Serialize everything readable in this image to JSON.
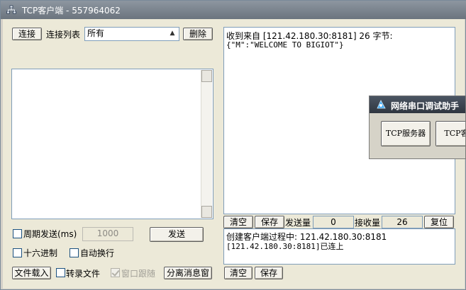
{
  "window": {
    "title": "TCP客户端 - 557964062"
  },
  "toolbar": {
    "connect_label": "连接",
    "conn_list_label": "连接列表",
    "conn_select_value": "所有",
    "delete_label": "删除"
  },
  "receive": {
    "lines": [
      "收到来自 [121.42.180.30:8181] 26 字节:",
      "{\"M\":\"WELCOME TO BIGIOT\"}"
    ]
  },
  "rx_bar": {
    "clear_label": "清空",
    "save_label": "保存",
    "sent_label": "发送量",
    "sent_value": "0",
    "recv_label": "接收量",
    "recv_value": "26",
    "reset_label": "复位"
  },
  "send_panel": {
    "periodic_label": "周期发送(ms)",
    "periodic_value": "1000",
    "send_label": "发送",
    "hex_label": "十六进制",
    "autowrap_label": "自动换行",
    "load_file_label": "文件载入",
    "to_file_label": "转录文件",
    "follow_label": "窗口跟随",
    "detach_label": "分离消息窗"
  },
  "log": {
    "lines": [
      "创建客户端过程中: 121.42.180.30:8181",
      "[121.42.180.30:8181]已连上"
    ],
    "clear_label": "清空",
    "save_label": "保存"
  },
  "popup": {
    "title": "网络串口调试助手",
    "tcp_server_label": "TCP服务器",
    "tcp_client_label": "TCP客户"
  },
  "colors": {
    "title_bar": "#7a838d",
    "panel": "#ece9d8",
    "popup_title": "#3b434d"
  },
  "icons": {
    "app": "network-icon",
    "popup": "signal-icon"
  }
}
